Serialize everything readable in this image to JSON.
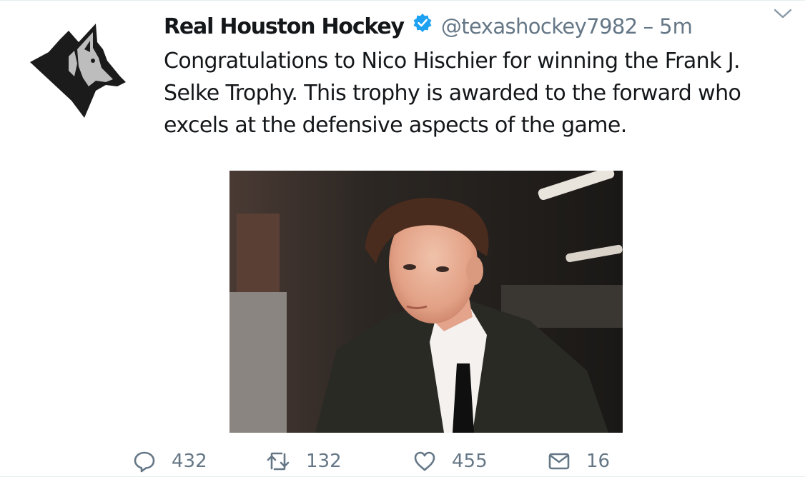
{
  "tweet": {
    "author_name": "Real Houston Hockey",
    "handle": "@texashockey7982",
    "separator": "–",
    "time": "5m",
    "text": "Congratulations to Nico Hischier for winning the Frank J. Selke Trophy. This trophy is awarded to the forward who excels at the defensive aspects of the game.",
    "verified": true,
    "avatar_icon": "wolf-logo-icon",
    "menu_icon": "chevron-down-icon"
  },
  "actions": {
    "reply_count": "432",
    "retweet_count": "132",
    "like_count": "455",
    "message_count": "16"
  },
  "colors": {
    "verified_blue": "#1da1f2",
    "secondary_text": "#657786",
    "primary_text": "#14171a",
    "caret": "#8899a6"
  }
}
